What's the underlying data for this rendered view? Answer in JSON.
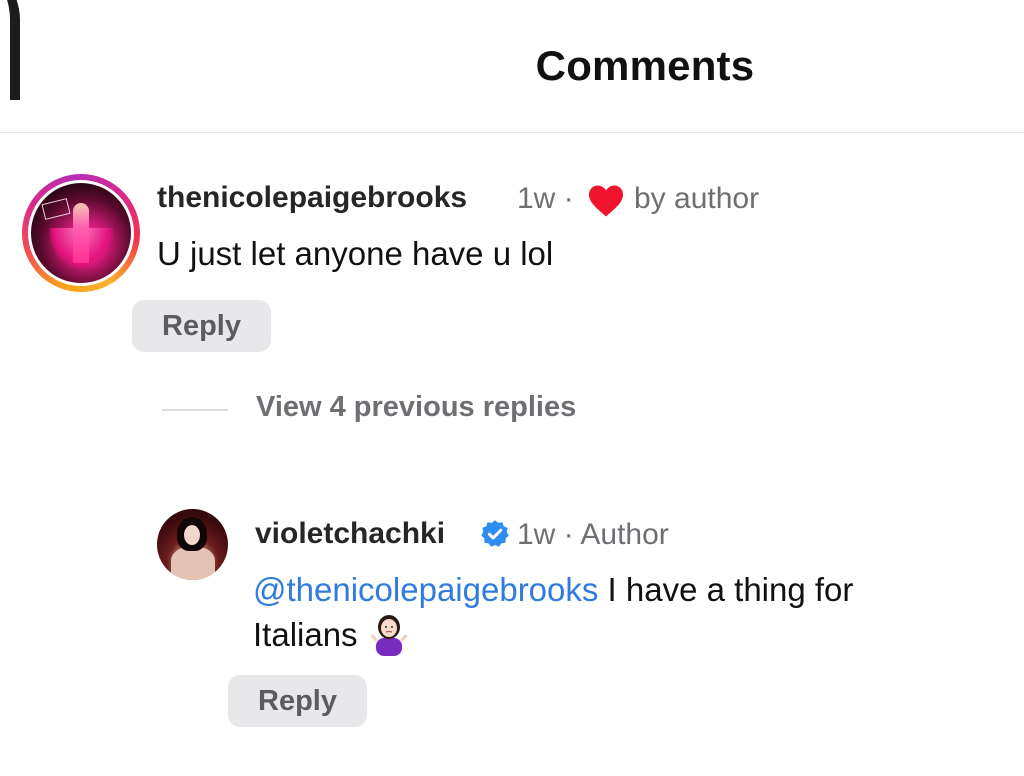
{
  "header": {
    "title": "Comments"
  },
  "comments": [
    {
      "username": "thenicolepaigebrooks",
      "time": "1w",
      "separator": "·",
      "liked_label": "by author",
      "text": "U just let anyone have u lol",
      "reply_label": "Reply"
    }
  ],
  "view_replies": {
    "label": "View 4 previous replies"
  },
  "replies": [
    {
      "username": "violetchachki",
      "verified": true,
      "time": "1w",
      "separator": "·",
      "role_label": "Author",
      "mention": "@thenicolepaigebrooks",
      "text_line1": " I have a thing for",
      "text_line2": "Italians ",
      "emoji": "person-shrugging-emoji",
      "reply_label": "Reply"
    }
  ],
  "colors": {
    "mention": "#2f7be0",
    "heart": "#f0142f",
    "verified": "#2f8cf0",
    "reply_bg": "#e8e8ea"
  }
}
